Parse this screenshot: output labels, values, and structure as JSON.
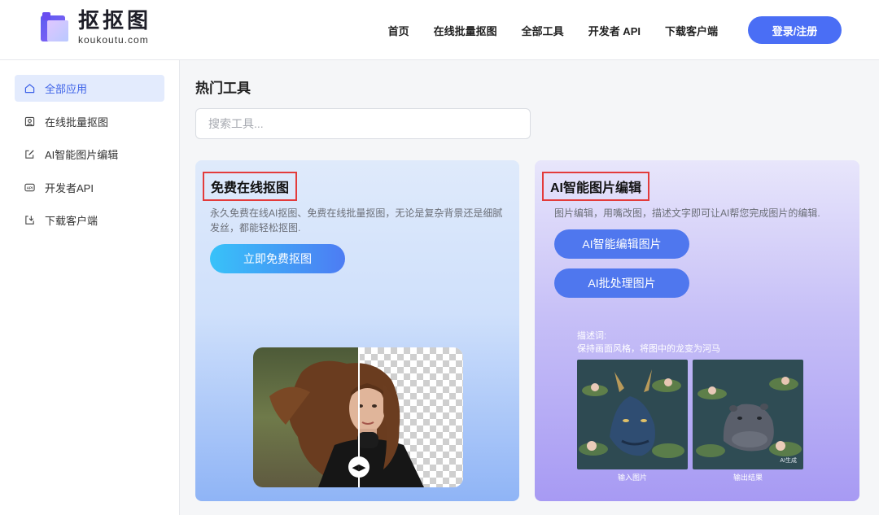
{
  "header": {
    "logo_name": "抠抠图",
    "logo_domain": "koukoutu.com",
    "nav": [
      "首页",
      "在线批量抠图",
      "全部工具",
      "开发者 API",
      "下载客户端"
    ],
    "login_label": "登录/注册"
  },
  "sidebar": {
    "items": [
      {
        "label": "全部应用",
        "icon": "home-icon",
        "active": true
      },
      {
        "label": "在线批量抠图",
        "icon": "portrait-frame-icon",
        "active": false
      },
      {
        "label": "AI智能图片编辑",
        "icon": "edit-icon",
        "active": false
      },
      {
        "label": "开发者API",
        "icon": "api-icon",
        "active": false
      },
      {
        "label": "下载客户端",
        "icon": "download-icon",
        "active": false
      }
    ]
  },
  "main": {
    "title": "热门工具",
    "search_placeholder": "搜索工具...",
    "cards": {
      "cutout": {
        "title": "免费在线抠图",
        "desc": "永久免费在线AI抠图、免费在线批量抠图，无论是复杂背景还是细腻发丝，都能轻松抠图.",
        "cta": "立即免费抠图"
      },
      "ai_edit": {
        "title": "AI智能图片编辑",
        "desc": "图片编辑，用嘴改图，描述文字即可让AI帮您完成图片的编辑.",
        "cta_primary": "AI智能编辑图片",
        "cta_secondary": "AI批处理图片",
        "prompt_label": "描述词:",
        "prompt_text": "保持画面风格，将图中的龙变为河马",
        "input_caption": "输入图片",
        "output_caption": "输出结果",
        "output_tag": "AI生成"
      }
    }
  },
  "colors": {
    "accent": "#4a6ef5",
    "highlight_border": "#e33b3b",
    "sidebar_active_bg": "#e3ebfd"
  }
}
